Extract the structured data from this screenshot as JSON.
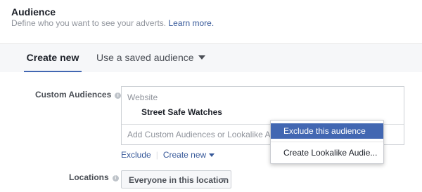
{
  "header": {
    "title": "Audience",
    "subtitle": "Define who you want to see your adverts.",
    "learn_more": "Learn more."
  },
  "tabs": [
    {
      "label": "Create new",
      "active": true
    },
    {
      "label": "Use a saved audience",
      "active": false
    }
  ],
  "custom_audiences": {
    "label": "Custom Audiences",
    "group_label": "Website",
    "selected_item": "Street Safe Watches",
    "input_placeholder": "Add Custom Audiences or Lookalike Audiences",
    "exclude_label": "Exclude",
    "create_new_label": "Create new"
  },
  "dropdown_menu": {
    "items": [
      "Exclude this audience",
      "Create Lookalike Audie..."
    ]
  },
  "locations": {
    "label": "Locations",
    "selected": "Everyone in this location"
  },
  "colors": {
    "accent": "#4267b2",
    "link": "#365899",
    "highlight": "#4267b2"
  }
}
